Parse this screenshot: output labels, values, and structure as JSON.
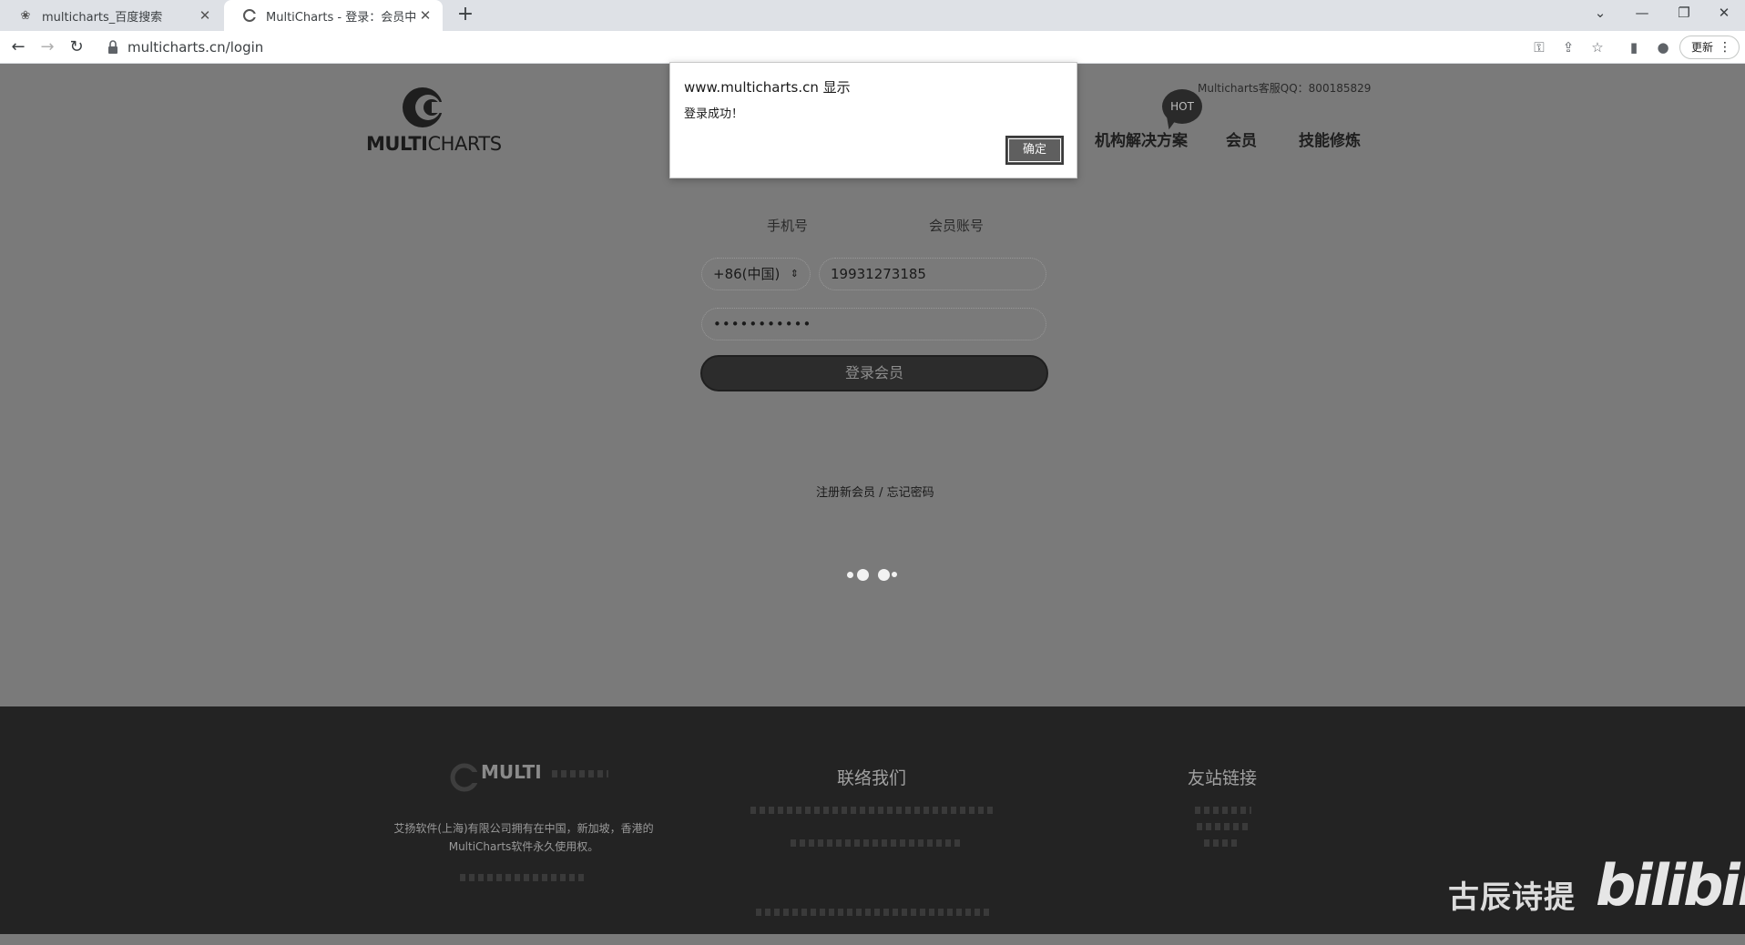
{
  "browser": {
    "tabs": [
      {
        "title": "multicharts_百度搜索",
        "icon": "paw-icon",
        "active": false
      },
      {
        "title": "MultiCharts - 登录：会员中心",
        "icon": "multicharts-icon",
        "active": true
      }
    ],
    "url": "multicharts.cn/login",
    "update_label": "更新"
  },
  "header": {
    "logo_bold": "MULTI",
    "logo_rest": "CHARTS",
    "qq": "Multicharts客服QQ：800185829",
    "hot_badge": "HOT",
    "nav": [
      "机构解决方案",
      "会员",
      "技能修炼"
    ]
  },
  "login": {
    "tab_phone": "手机号",
    "tab_account": "会员账号",
    "country_code": "+86(中国)",
    "phone": "19931273185",
    "password": "•••••••••••",
    "submit": "登录会员",
    "register": "注册新会员",
    "separator": " / ",
    "forgot": "忘记密码"
  },
  "footer": {
    "logo": "MULTI",
    "desc": "艾扬软件(上海)有限公司拥有在中国，新加坡，香港的MultiCharts软件永久使用权。",
    "contact_heading": "联络我们",
    "links_heading": "友站链接"
  },
  "alert": {
    "title": "www.multicharts.cn 显示",
    "message": "登录成功！",
    "ok": "确定"
  },
  "watermark": {
    "text": "古辰诗提",
    "logo": "bilibili"
  }
}
